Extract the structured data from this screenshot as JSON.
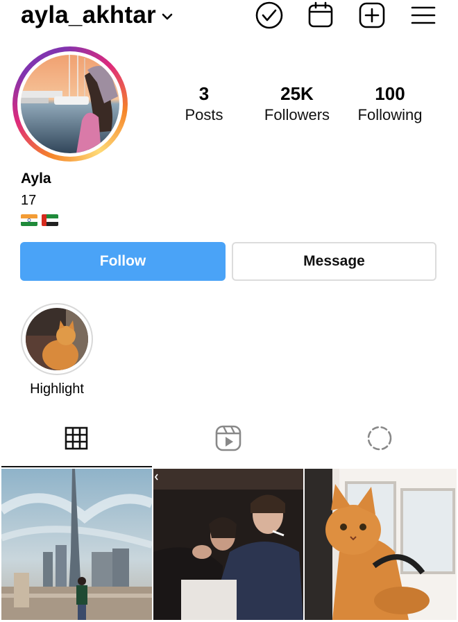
{
  "header": {
    "username": "ayla_akhtar"
  },
  "stats": [
    {
      "value": "3",
      "label": "Posts"
    },
    {
      "value": "25K",
      "label": "Followers"
    },
    {
      "value": "100",
      "label": "Following"
    }
  ],
  "profile": {
    "name": "Ayla",
    "bio": "17",
    "flags": [
      "india-flag",
      "uae-flag"
    ]
  },
  "actions": {
    "follow_label": "Follow",
    "message_label": "Message"
  },
  "highlight": {
    "label": "Highlight"
  },
  "tabs": [
    "grid-icon",
    "reels-icon",
    "tagged-icon"
  ],
  "colors": {
    "follow_button": "#4aa3f7",
    "border": "#dcdcdc"
  }
}
